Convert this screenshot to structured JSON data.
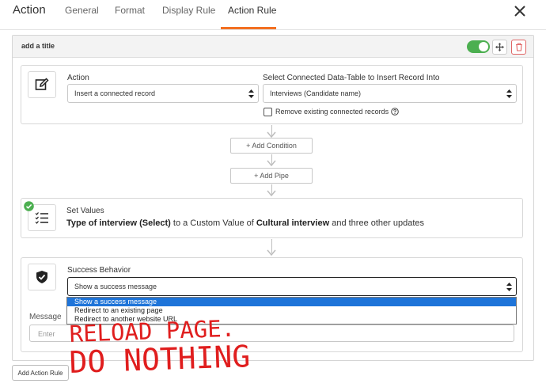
{
  "header": {
    "title": "Action",
    "tabs": [
      "General",
      "Format",
      "Display Rule",
      "Action Rule"
    ],
    "active_tab": "Action Rule"
  },
  "rule": {
    "title": "add a title",
    "enabled": true
  },
  "action_step": {
    "action_label": "Action",
    "action_value": "Insert a connected record",
    "table_label": "Select Connected Data-Table to Insert Record Into",
    "table_value": "Interviews (Candidate name)",
    "remove_label": "Remove existing connected records",
    "remove_checked": false
  },
  "connectors": {
    "add_condition": "+ Add Condition",
    "add_pipe": "+ Add Pipe"
  },
  "set_values": {
    "label": "Set Values",
    "t1": "Type of interview (Select)",
    "t2": " to a Custom Value of ",
    "t3": "Cultural interview",
    "t4": " and three other updates"
  },
  "success": {
    "label": "Success Behavior",
    "value": "Show a success message",
    "options": [
      "Show a success message",
      "Redirect to an existing page",
      "Redirect to another website URL"
    ],
    "selected_index": 0,
    "message_label": "Message",
    "message_placeholder": "Enter"
  },
  "annotation": {
    "line1": "RELOAD PAGE.",
    "line2": "DO NOTHING",
    "color": "#e01e1e"
  },
  "footer": {
    "add_action_rule": "Add Action Rule"
  },
  "colors": {
    "accent": "#f37021",
    "toggle_on": "#4caf50",
    "delete": "#e06565",
    "selected_option": "#1e74d9"
  }
}
